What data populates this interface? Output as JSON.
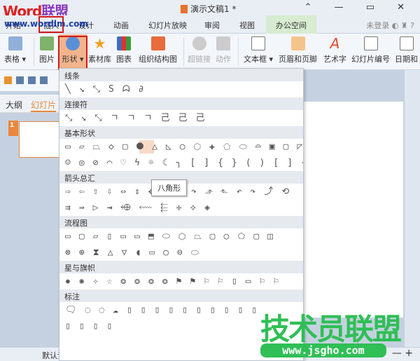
{
  "logo": {
    "text": "Word联盟",
    "url": "www.wordlm.com"
  },
  "title": "演示文稿1 *",
  "window_buttons": "⌃ — ▭ ✕",
  "tabs": [
    "开始",
    "插入",
    "设计",
    "动画",
    "幻灯片放映",
    "审阅",
    "视图",
    "办公空间"
  ],
  "tab_right": "未登录",
  "ribbon": [
    "表格 ▾",
    "图片",
    "形状 ▾",
    "素材库",
    "图表",
    "组织结构图",
    "超链接",
    "动作",
    "文本框 ▾",
    "页眉和页脚",
    "艺术字",
    "幻灯片编号",
    "日期和"
  ],
  "pane_tabs": [
    "大纲",
    "幻灯片"
  ],
  "slide_number": "1",
  "status_left": "默认设",
  "menu": {
    "sections": [
      {
        "title": "线条",
        "rows": [
          "╲↘⤡Sᗣ∂"
        ]
      },
      {
        "title": "连接符",
        "rows": [
          "⤡↘⤡ㄱㄱㄱ己己己"
        ]
      },
      {
        "title": "基本形状",
        "rows": [
          "▭▱⏢◇▢⯃△◺○⬡✚⬠⬭⌓▣▢◸",
          "☺◎⊘⌒♡ϟ☼☾╮[]{}()[]{}"
        ]
      },
      {
        "title": "箭头总汇",
        "rows": [
          "⇨⇦⇧⇩⇔⇕✥⥣↱↷⬏⬑↶↷⤴⟲",
          "⇉⇛▷⇥⬲⬳⬱✛⟡◈"
        ]
      },
      {
        "title": "流程图",
        "rows": [
          "▭▢▱▯▭▭⬒⬭⬡⏢▢○⬠▢◫",
          "⊗⊕⧗△▽◖▭○⊖⬭"
        ]
      },
      {
        "title": "星与旗帜",
        "rows": [
          "✹✺✧☆❂❂❂❂⚑⚑⚐⚐▯▭⚐⚐"
        ]
      },
      {
        "title": "标注",
        "rows": [
          "🗨◌◌☁▯▯▯▯▯▯▯▯▯▯",
          "▯▯▯▯"
        ]
      }
    ],
    "selected": "八角形"
  },
  "tooltip": "八角形",
  "watermark": {
    "text": "技术员联盟",
    "url": "www.jsgho.com"
  }
}
